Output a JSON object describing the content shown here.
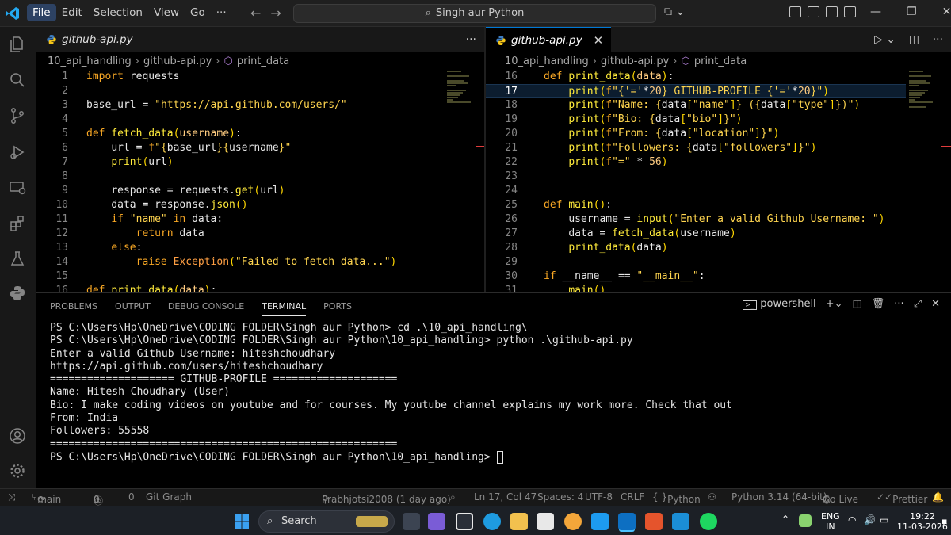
{
  "titlebar": {
    "menu": [
      "File",
      "Edit",
      "Selection",
      "View",
      "Go"
    ],
    "more": "···",
    "search": "Singh aur Python",
    "brand_color": "#0078d4"
  },
  "editor_left": {
    "tab": "github-api.py",
    "breadcrumb": [
      "10_api_handling",
      "github-api.py",
      "print_data"
    ],
    "line_numbers": [
      1,
      2,
      3,
      4,
      5,
      6,
      7,
      8,
      9,
      10,
      11,
      12,
      13,
      14,
      15,
      16
    ]
  },
  "editor_right": {
    "tab": "github-api.py",
    "breadcrumb": [
      "10_api_handling",
      "github-api.py",
      "print_data"
    ],
    "line_numbers": [
      16,
      17,
      18,
      19,
      20,
      21,
      22,
      23,
      24,
      25,
      26,
      27,
      28,
      29,
      30,
      31
    ],
    "current_line": 17
  },
  "panel": {
    "tabs": [
      "PROBLEMS",
      "OUTPUT",
      "DEBUG CONSOLE",
      "TERMINAL",
      "PORTS"
    ],
    "active_tab": "TERMINAL",
    "shell": "powershell",
    "terminal_lines": [
      "PS C:\\Users\\Hp\\OneDrive\\CODING FOLDER\\Singh aur Python> cd .\\10_api_handling\\",
      "PS C:\\Users\\Hp\\OneDrive\\CODING FOLDER\\Singh aur Python\\10_api_handling> python .\\github-api.py",
      "Enter a valid Github Username: hiteshchoudhary",
      "https://api.github.com/users/hiteshchoudhary",
      "==================== GITHUB-PROFILE ====================",
      "Name: Hitesh Choudhary (User)",
      "Bio: I make coding videos on youtube and for courses. My youtube channel explains my work more. Check that out",
      "From: India",
      "Followers: 55558",
      "========================================================",
      "PS C:\\Users\\Hp\\OneDrive\\CODING FOLDER\\Singh aur Python\\10_api_handling> "
    ]
  },
  "statusbar": {
    "branch": "main",
    "errors": "0",
    "warnings": "0",
    "ports": "0",
    "git_graph": "Git Graph",
    "blame": "Prabhjotsi2008 (1 day ago)",
    "cursor": "Ln 17, Col 47",
    "spaces": "Spaces: 4",
    "encoding": "UTF-8",
    "eol": "CRLF",
    "language": "Python",
    "interpreter": "Python 3.14 (64-bit)",
    "golive": "Go Live",
    "prettier": "Prettier"
  },
  "taskbar": {
    "search": "Search",
    "lang_top": "ENG",
    "lang_bottom": "IN",
    "time": "19:22",
    "date": "11-03-2026"
  }
}
